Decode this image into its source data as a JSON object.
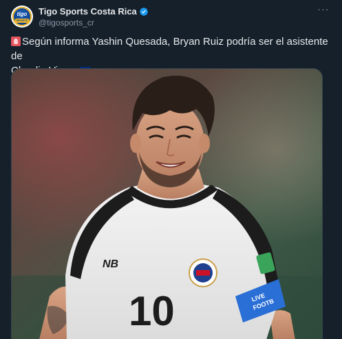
{
  "author": {
    "display_name": "Tigo Sports Costa Rica",
    "handle": "@tigosports_cr",
    "verified": true,
    "avatar_text": "tigo",
    "avatar_subtext": "SPORTS"
  },
  "menu": {
    "more_label": "···"
  },
  "tweet": {
    "text_line_1": "Según informa Yashin Quesada, Bryan Ruiz podría ser el asistente de",
    "text_line_2": "Claudio Vivas.",
    "leading_emoji": "siren-icon",
    "trailing_emoji": "costa-rica-flag-icon"
  },
  "media": {
    "jersey_number": "10",
    "jersey_brand": "NB",
    "armband_text_1": "LIVE",
    "armband_text_2": "FOOTB"
  },
  "colors": {
    "background": "#15202b",
    "text_primary": "#e7e9ea",
    "text_secondary": "#8b98a5",
    "verified_blue": "#1d9bf0",
    "border": "#38444d"
  }
}
